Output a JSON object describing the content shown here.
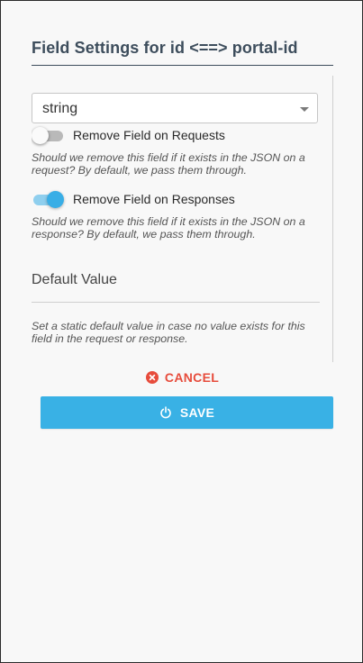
{
  "dialog": {
    "title": "Field Settings for id <==> portal-id"
  },
  "type_select": {
    "value": "string",
    "icon": "chevron-down-icon"
  },
  "remove_on_requests": {
    "label": "Remove Field on Requests",
    "enabled": false,
    "help": "Should we remove this field if it exists in the JSON on a request? By default, we pass them through."
  },
  "remove_on_responses": {
    "label": "Remove Field on Responses",
    "enabled": true,
    "help": "Should we remove this field if it exists in the JSON on a response? By default, we pass them through."
  },
  "default_value": {
    "label": "Default Value",
    "value": "",
    "help": "Set a static default value in case no value exists for this field in the request or response."
  },
  "actions": {
    "cancel_label": "CANCEL",
    "cancel_icon": "close-circle-icon",
    "save_label": "SAVE",
    "save_icon": "power-icon"
  },
  "colors": {
    "title": "#3d4d5c",
    "accent": "#39b1e5",
    "danger": "#e74c3c",
    "background": "#f8f8f8"
  }
}
